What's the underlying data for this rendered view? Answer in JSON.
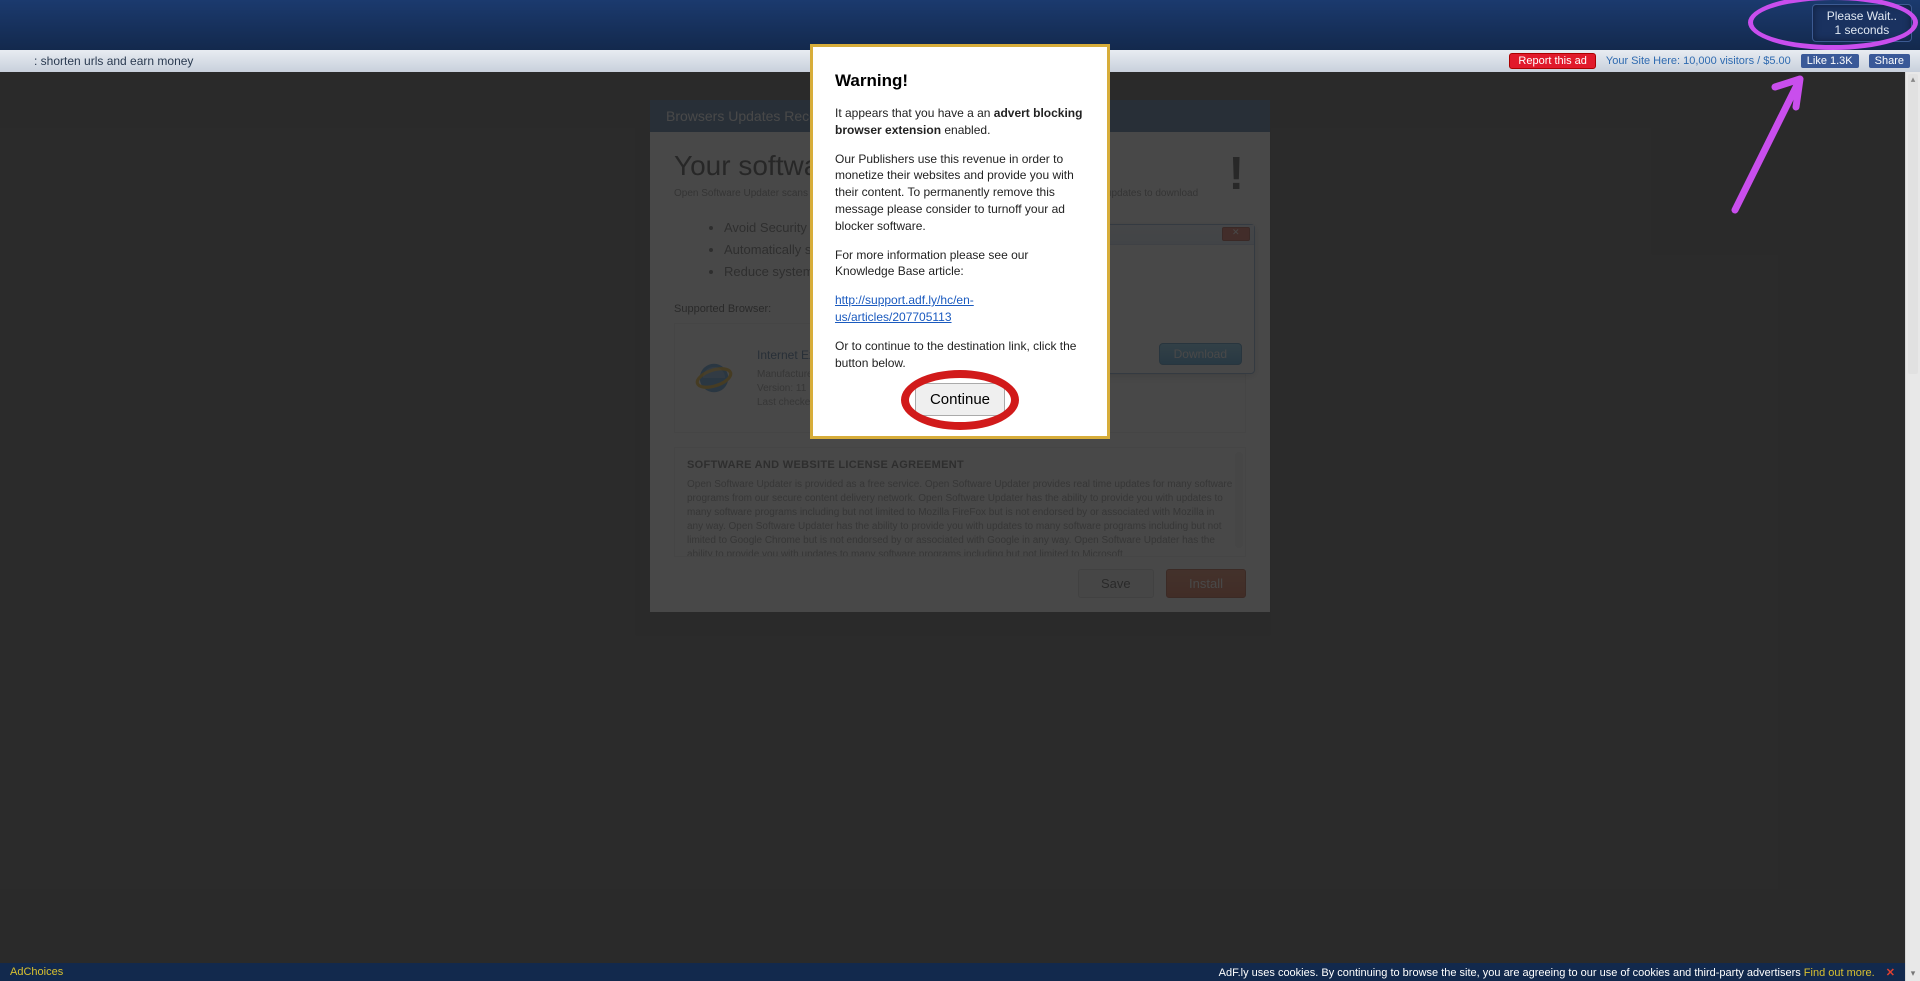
{
  "topbar": {
    "wait_line1": "Please Wait..",
    "wait_line2": "1 seconds"
  },
  "subbar": {
    "left_text": ": shorten urls and earn money",
    "report_label": "Report this ad",
    "your_site_text": "Your Site Here: 10,000 visitors / $5.00",
    "like_label": "Like 1.3K",
    "share_label": "Share"
  },
  "ad": {
    "header_text": "Browsers Updates Recommended",
    "h1": "Your software may be out of date",
    "sub": "Open Software Updater scans your computer for out of date software and recommends the latest updates to download",
    "bullets": [
      "Avoid Security risks and keep your Windows updated",
      "Automatically scans for outdated software",
      "Reduce system crashes by keeping software updated"
    ],
    "supported_label": "Supported Browser:",
    "browser": {
      "name": "Internet Explorer",
      "manufacturer": "Manufacturer: Microsoft Corp.",
      "version": "Version: 11",
      "checked": "Last checked: 11/28/2015"
    },
    "download_label": "Download",
    "eula_title": "SOFTWARE AND WEBSITE LICENSE AGREEMENT",
    "eula_body": "Open Software Updater is provided as a free service. Open Software Updater provides real time updates for many software programs from our secure content delivery network. Open Software Updater has the ability to provide you with updates to many software programs including but not limited to Mozilla FireFox but is not endorsed by or associated with Mozilla in any way. Open Software Updater has the ability to provide you with updates to many software programs including but not limited to Google Chrome but is not endorsed by or associated with Google in any way. Open Software Updater has the ability to provide you with updates to many software programs including but not limited to Microsoft",
    "save_label": "Save",
    "install_label": "Install"
  },
  "modal": {
    "title": "Warning!",
    "p1_a": "It appears that you have a an ",
    "p1_b": "advert blocking browser extension",
    "p1_c": " enabled.",
    "p2": "Our Publishers use this revenue in order to monetize their websites and provide you with their content. To permanently remove this message please consider to turnoff your ad blocker software.",
    "p3": "For more information please see our Knowledge Base article:",
    "link": "http://support.adf.ly/hc/en-us/articles/207705113",
    "p4": "Or to continue to the destination link, click the button below.",
    "continue_label": "Continue"
  },
  "cookiebar": {
    "adchoices": "AdChoices",
    "text": "AdF.ly uses cookies. By continuing to browse the site, you are agreeing to our use of cookies and third-party advertisers ",
    "link": "Find out more."
  }
}
